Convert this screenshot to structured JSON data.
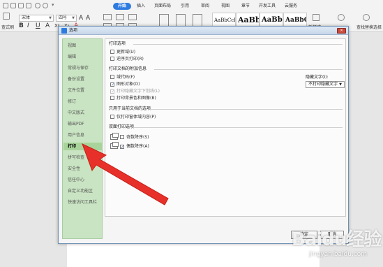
{
  "ribbon": {
    "tabs": [
      "开始",
      "插入",
      "页面布局",
      "引用",
      "审阅",
      "视图",
      "章节",
      "开发工具",
      "云服务"
    ],
    "active_tab": "开始",
    "font_name": "宋体",
    "font_size": "四号",
    "left_label": "查式刷",
    "format_glyphs": [
      "B",
      "I",
      "U",
      "A",
      "X²",
      "X₂",
      "A"
    ],
    "styles": [
      "AaBbCcI",
      "AaBb",
      "AaBb(",
      "AaBbC("
    ],
    "new_style_label": "新样式",
    "find_replace_label": "查找替换",
    "select_label": "选择"
  },
  "dialog": {
    "title": "选项",
    "close": "×",
    "sidebar": [
      "视图",
      "编辑",
      "常规与保存",
      "备份设置",
      "文件位置",
      "修订",
      "中文版式",
      "输出PDF",
      "用户信息",
      "打印",
      "拼写检查",
      "安全性",
      "信任中心",
      "自定义功能区",
      "快速访问工具栏"
    ],
    "selected_item": "打印",
    "sections": {
      "print_options": {
        "title": "打印选项",
        "items": [
          {
            "label": "更新域(U)",
            "checked": false
          },
          {
            "label": "逆序页打印(R)",
            "checked": false
          }
        ]
      },
      "include_with_document": {
        "title": "打印文档的附加信息",
        "items": [
          {
            "label": "域代码(F)",
            "checked": false,
            "dim": false
          },
          {
            "label": "图形对象(O)",
            "checked": true,
            "dim": false
          },
          {
            "label": "打印隐藏文字下划线(L)",
            "checked": true,
            "dim": true
          },
          {
            "label": "打印背景色和图像(B)",
            "checked": false,
            "dim": false
          }
        ],
        "hidden_text_label": "隐藏文字(I):",
        "hidden_text_value": "不打印隐藏文字"
      },
      "current_document_only": {
        "title": "只用于当前文档的选项",
        "items": [
          {
            "label": "仅打印窗体域内容(P)",
            "checked": false
          }
        ]
      },
      "duplex": {
        "title": "双面打印选项",
        "items": [
          {
            "label": "奇数降序(S)",
            "checked": false
          },
          {
            "label": "偶数降序(A)",
            "checked": true
          }
        ]
      }
    },
    "ok_button": "确定",
    "cancel_button": "取消"
  },
  "watermark": {
    "logo": "Baidu经验",
    "url": "jingyan.baidu.com"
  },
  "colors": {
    "sidebar_bg": "#c9e4c2",
    "sidebar_selected": "#a8d49b",
    "active_tab": "#2e7be0",
    "arrow": "#e8302a"
  },
  "icons": [
    "print-options-icon",
    "duplex-page-icon",
    "dialog-app-icon",
    "close-icon",
    "pointer-arrow"
  ]
}
